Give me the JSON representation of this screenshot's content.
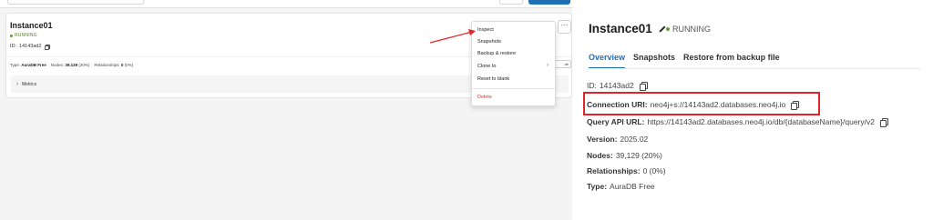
{
  "left": {
    "instance": {
      "name": "Instance01",
      "status": "RUNNING",
      "id_label": "ID:",
      "id_value": "14143ad2",
      "stats": {
        "type_label": "Type:",
        "type_value": "AuraDB Free",
        "nodes_label": "Nodes:",
        "nodes_value": "39,129",
        "nodes_pct": "(20%)",
        "rel_label": "Relationships:",
        "rel_value": "0",
        "rel_pct": "(0%)"
      },
      "open_button": "de",
      "more_button": "···",
      "metrics_label": "Metrics"
    },
    "menu": {
      "items": [
        "Inspect",
        "Snapshots",
        "Backup & restore",
        "Clone to",
        "Reset to blank",
        "Delete"
      ]
    }
  },
  "right": {
    "title": "Instance01",
    "status": "RUNNING",
    "tabs": [
      "Overview",
      "Snapshots",
      "Restore from backup file"
    ],
    "id": {
      "label": "ID:",
      "value": "14143ad2"
    },
    "connection_uri": {
      "label": "Connection URI:",
      "value": "neo4j+s://14143ad2.databases.neo4j.io"
    },
    "query_api_url": {
      "label": "Query API URL:",
      "value": "https://14143ad2.databases.neo4j.io/db/{databaseName}/query/v2"
    },
    "version": {
      "label": "Version:",
      "value": "2025.02"
    },
    "nodes": {
      "label": "Nodes:",
      "value": "39,129 (20%)"
    },
    "relationships": {
      "label": "Relationships:",
      "value": "0 (0%)"
    },
    "type": {
      "label": "Type:",
      "value": "AuraDB Free"
    }
  },
  "colors": {
    "accent": "#1f6fb7",
    "running": "#6a9a3c",
    "highlight": "#e0252a",
    "delete": "#d33a2b"
  }
}
